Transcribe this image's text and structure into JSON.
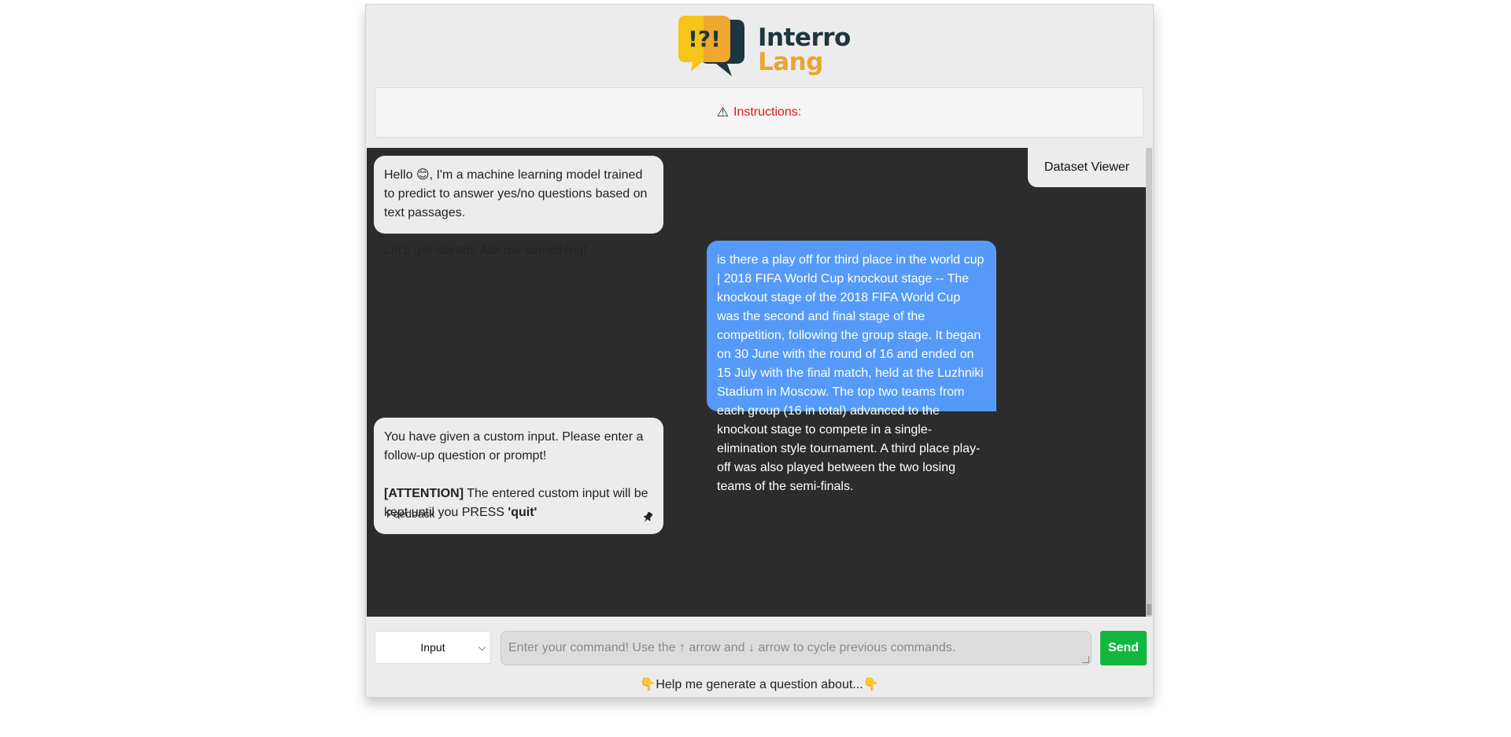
{
  "header": {
    "logo_icon_text": "!?!",
    "logo_line1": "Interro",
    "logo_line2": "Lang",
    "instructions_icon": "⚠",
    "instructions_label": "Instructions:"
  },
  "chat": {
    "dataset_viewer_label": "Dataset Viewer",
    "messages": [
      {
        "role": "bot",
        "p1": "Hello 😊, I'm a machine learning model trained to predict to answer yes/no questions based on text passages.",
        "p2": "Let's get started. Ask me something!"
      },
      {
        "role": "user",
        "text": "is there a play off for third place in the world cup | 2018 FIFA World Cup knockout stage -- The knockout stage of the 2018 FIFA World Cup was the second and final stage of the competition, following the group stage. It began on 30 June with the round of 16 and ended on 15 July with the final match, held at the Luzhniki Stadium in Moscow. The top two teams from each group (16 in total) advanced to the knockout stage to compete in a single-elimination style tournament. A third place play-off was also played between the two losing teams of the semi-finals."
      },
      {
        "role": "bot",
        "p1": "You have given a custom input. Please enter a follow-up question or prompt!",
        "attention_label": "[ATTENTION]",
        "attention_text": " The entered custom input will be kept until you PRESS ",
        "quit_label": "'quit'",
        "feedback_label": "Feedback",
        "pin_icon": "pushpin-icon"
      }
    ]
  },
  "input": {
    "mode_selected": "Input",
    "placeholder": "Enter your command! Use the ↑ arrow and ↓ arrow to cycle previous commands.",
    "send_label": "Send"
  },
  "help": {
    "left_emoji": "👇",
    "text": "Help me generate a question about...",
    "right_emoji": "👇"
  },
  "colors": {
    "user_bubble": "#559af8",
    "bot_bubble": "#ececec",
    "chat_background": "#2c2c2c",
    "send_button": "#12b83e",
    "instructions_text": "#e0141e"
  }
}
